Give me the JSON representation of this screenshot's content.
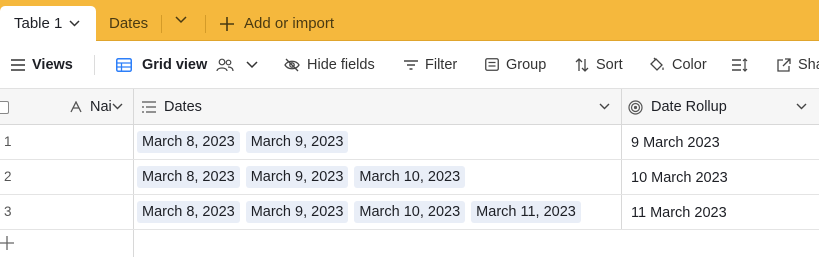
{
  "tabs": {
    "active_table": "Table 1",
    "second_table": "Dates",
    "add_import": "Add or import"
  },
  "toolbar": {
    "views": "Views",
    "grid_view": "Grid view",
    "hide_fields": "Hide fields",
    "filter": "Filter",
    "group": "Group",
    "sort": "Sort",
    "color": "Color",
    "share": "Sha"
  },
  "columns": {
    "name": "Nai",
    "dates": "Dates",
    "rollup": "Date Rollup"
  },
  "rows": [
    {
      "num": "1",
      "dates": [
        "March 8, 2023",
        "March 9, 2023"
      ],
      "rollup": "9 March 2023"
    },
    {
      "num": "2",
      "dates": [
        "March 8, 2023",
        "March 9, 2023",
        "March 10, 2023"
      ],
      "rollup": "10 March 2023"
    },
    {
      "num": "3",
      "dates": [
        "March 8, 2023",
        "March 9, 2023",
        "March 10, 2023",
        "March 11, 2023"
      ],
      "rollup": "11 March 2023"
    }
  ],
  "colors": {
    "tabbar": "#f5b83d",
    "pill": "#e9eef7",
    "grid_icon": "#2d7ff9"
  },
  "icons": {
    "tab_chevron": "chevron-down-icon",
    "add": "plus-icon",
    "views": "hamburger-icon",
    "grid": "grid-icon",
    "collaborators": "people-icon",
    "hide": "eye-slash-icon",
    "filter": "filter-icon",
    "group": "group-icon",
    "sort": "sort-icon",
    "color": "paint-bucket-icon",
    "row_height": "row-height-icon",
    "share": "share-icon",
    "name_field": "text-field-icon",
    "dates_field": "multiple-records-icon",
    "rollup_field": "rollup-icon"
  }
}
